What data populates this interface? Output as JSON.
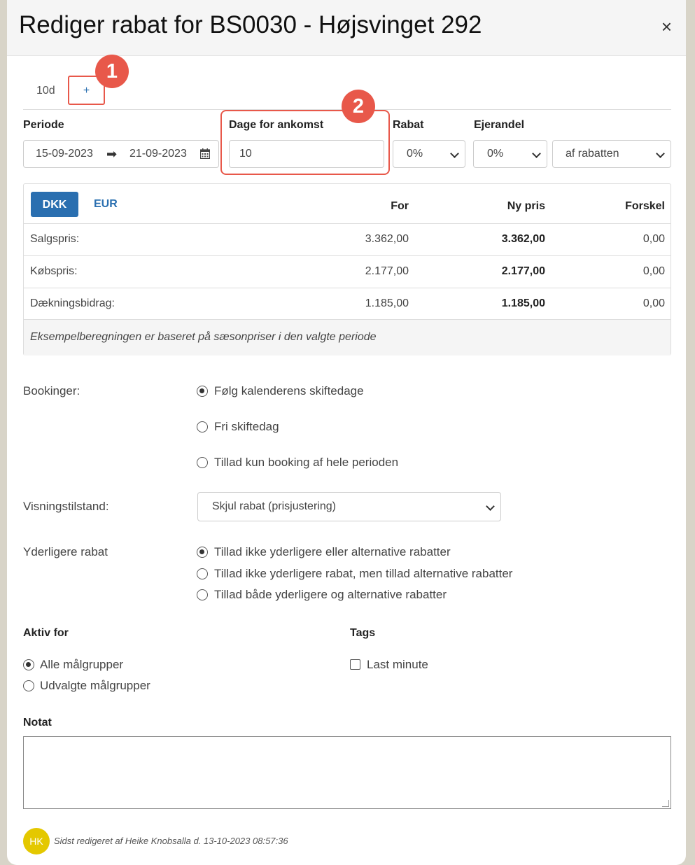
{
  "dialog": {
    "title": "Rediger rabat for BS0030 - Højsvinget 292",
    "close_label": "×"
  },
  "tabs": {
    "items": [
      "10d"
    ],
    "add_label": "+"
  },
  "annotations": [
    "1",
    "2"
  ],
  "period": {
    "label": "Periode",
    "from": "15-09-2023",
    "to": "21-09-2023"
  },
  "days_before": {
    "label": "Dage for ankomst",
    "value": "10"
  },
  "discount": {
    "label": "Rabat",
    "value": "0%"
  },
  "ownership": {
    "label": "Ejerandel",
    "value": "0%",
    "basis": "af rabatten"
  },
  "price_table": {
    "currency_buttons": [
      "DKK",
      "EUR"
    ],
    "active_currency": "DKK",
    "headers": [
      "For",
      "Ny pris",
      "Forskel"
    ],
    "rows": [
      {
        "label": "Salgspris:",
        "before": "3.362,00",
        "new": "3.362,00",
        "diff": "0,00"
      },
      {
        "label": "Købspris:",
        "before": "2.177,00",
        "new": "2.177,00",
        "diff": "0,00"
      },
      {
        "label": "Dækningsbidrag:",
        "before": "1.185,00",
        "new": "1.185,00",
        "diff": "0,00"
      }
    ],
    "footnote": "Eksempelberegningen er baseret på sæsonpriser i den valgte periode"
  },
  "bookings": {
    "label": "Bookinger:",
    "options": [
      "Følg kalenderens skiftedage",
      "Fri skiftedag",
      "Tillad kun booking af hele perioden"
    ],
    "selected": 0
  },
  "display_mode": {
    "label": "Visningstilstand:",
    "value": "Skjul rabat (prisjustering)"
  },
  "additional_discount": {
    "label": "Yderligere rabat",
    "options": [
      "Tillad ikke yderligere eller alternative rabatter",
      "Tillad ikke yderligere rabat, men tillad alternative rabatter",
      "Tillad både yderligere og alternative rabatter"
    ],
    "selected": 0
  },
  "active_for": {
    "label": "Aktiv for",
    "options": [
      "Alle målgrupper",
      "Udvalgte målgrupper"
    ],
    "selected": 0
  },
  "tags": {
    "label": "Tags",
    "items": [
      {
        "label": "Last minute",
        "checked": false
      }
    ]
  },
  "note": {
    "label": "Notat",
    "value": ""
  },
  "footer": {
    "avatar_initials": "HK",
    "last_edited": "Sidst redigeret af Heike Knobsalla d. 13-10-2023 08:57:36"
  },
  "colors": {
    "primary": "#2a6fb0",
    "highlight": "#e8584a",
    "avatar": "#e4c800"
  }
}
